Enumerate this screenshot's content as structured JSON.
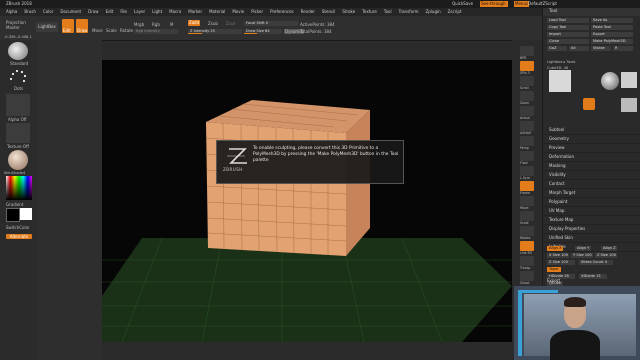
{
  "window": {
    "title": "ZBrush 2018"
  },
  "menubar": {
    "items": [
      "Alpha",
      "Brush",
      "Color",
      "Document",
      "Draw",
      "Edit",
      "File",
      "Layer",
      "Light",
      "Macro",
      "Marker",
      "Material",
      "Movie",
      "Picker",
      "Preferences",
      "Render",
      "Stencil",
      "Stroke",
      "Texture",
      "Tool",
      "Transform",
      "Zplugin",
      "Zscript"
    ],
    "right": {
      "quicksave": "QuickSave",
      "see_through": "See-through",
      "menus": "Menus",
      "default_zscript": "DefaultZScript"
    }
  },
  "toolbar": {
    "projections": "Projection Master",
    "lightbox": "LightBox",
    "edit": "Edit",
    "draw": "Draw",
    "move": "Move",
    "scale": "Scale",
    "rotate": "Rotate",
    "mrgb": "Mrgb",
    "rgb": "Rgb",
    "m": "M",
    "zadd": "Zadd",
    "zsub": "Zsub",
    "zcut": "Zcut",
    "rgb_intensity": "Rgb Intensity",
    "z_intensity": "Z Intensity 25",
    "focal_shift": "Focal Shift 0",
    "draw_size": "Draw Size 64",
    "dynamic": "Dynamic",
    "active_points": "ActivePoints: 384",
    "total_points": "TotalPoints: 384"
  },
  "leftshelf": {
    "coords": "-0.356,-0.408,1",
    "standard_label": "Standard",
    "dots_label": "Dots",
    "alpha_label": "Alpha Off",
    "texture_label": "Texture Off",
    "material_label": "SkinShade4",
    "gradient_label": "Gradient",
    "switch_label": "SwitchColor",
    "alternate_label": "Alternate"
  },
  "popup": {
    "message": "To enable sculpting, please convert this 3D Primitive to a PolyMesh3D by pressing the 'Make PolyMesh3D' button in the Tool palette",
    "logo_text": "ZBRUSH"
  },
  "rightshelf": {
    "items": [
      "BPR",
      "SPix 3",
      "Scroll",
      "Zoom",
      "Actual",
      "AAHalf",
      "Persp",
      "Floor",
      "L.Sym",
      "Frame",
      "Move",
      "Scale",
      "Rotate",
      "Line Fill",
      "Transp",
      "Ghost",
      "Solo",
      "Xpose"
    ]
  },
  "toolpanel": {
    "title": "Tool",
    "buttons": [
      [
        "Load Tool",
        "Save As"
      ],
      [
        "Copy Tool",
        "Paste Tool"
      ],
      [
        "Import",
        "Export"
      ],
      [
        "Clone",
        "Make PolyMesh3D"
      ],
      [
        "GoZ",
        "All",
        "Visible",
        "R"
      ]
    ],
    "lightbox_tools": "Lightbox ▸ Tools",
    "current_tool": "Cube3D. 48",
    "thumbs": [
      "Cube3D",
      "SphereBrush",
      "PolyMesh3D",
      "SimpleBrush",
      "Cube3D"
    ],
    "submenu": [
      "Subtool",
      "Geometry",
      "Preview",
      "Deformation",
      "Masking",
      "Visibility",
      "Contact",
      "Morph Target",
      "Polypaint",
      "UV Map",
      "Texture Map",
      "Display Properties",
      "Unified Skin",
      "Initialize"
    ],
    "init": {
      "align": [
        "Align X",
        "Align Y",
        "Align Z"
      ],
      "size": [
        "X Size 100",
        "Y Size 100",
        "Z Size 100"
      ],
      "divs": [
        "Z Size 100",
        "Slides Count 4"
      ],
      "taper": "Taper",
      "htiles": "HDivide 28",
      "vtiles": "VDivide 13",
      "qcube": "QCube"
    },
    "export": "Export"
  },
  "colors": {
    "accent": "#e37c1a",
    "cube_face": "#e2a271",
    "cube_side": "#c7845a",
    "cube_top": "#d4946a",
    "floor": "#1f3a1c"
  }
}
